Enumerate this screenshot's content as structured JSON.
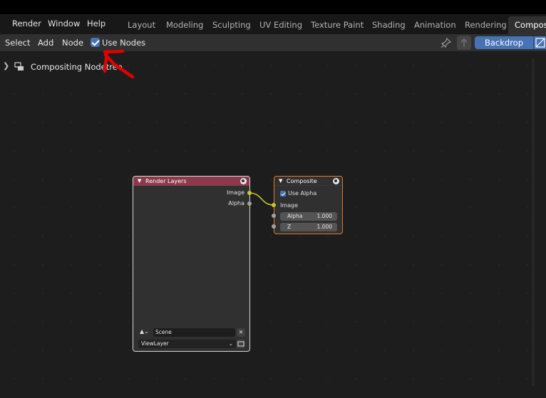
{
  "menubar": {
    "items": [
      "Render",
      "Window",
      "Help"
    ],
    "workspaces": [
      "Layout",
      "Modeling",
      "Sculpting",
      "UV Editing",
      "Texture Paint",
      "Shading",
      "Animation",
      "Rendering",
      "Composi"
    ]
  },
  "editor_header": {
    "select": "Select",
    "add": "Add",
    "node": "Node",
    "use_nodes_label": "Use Nodes",
    "use_nodes_checked": true,
    "backdrop": "Backdrop"
  },
  "breadcrumb": {
    "label": "Compositing Nodetree"
  },
  "nodes": {
    "render_layers": {
      "title": "Render Layers",
      "header_color": "#8b3a4c",
      "outputs": [
        "Image",
        "Alpha"
      ],
      "scene": "Scene",
      "view_layer": "ViewLayer"
    },
    "composite": {
      "title": "Composite",
      "use_alpha_label": "Use Alpha",
      "use_alpha_checked": true,
      "image_input": "Image",
      "alpha_label": "Alpha",
      "alpha_value": "1.000",
      "z_label": "Z",
      "z_value": "1.000"
    }
  },
  "colors": {
    "accent": "#4772b3",
    "selected_outline": "#e07a2e",
    "socket_image": "#c7c729",
    "socket_value": "#a1a1a1",
    "annotation": "#e00000"
  }
}
